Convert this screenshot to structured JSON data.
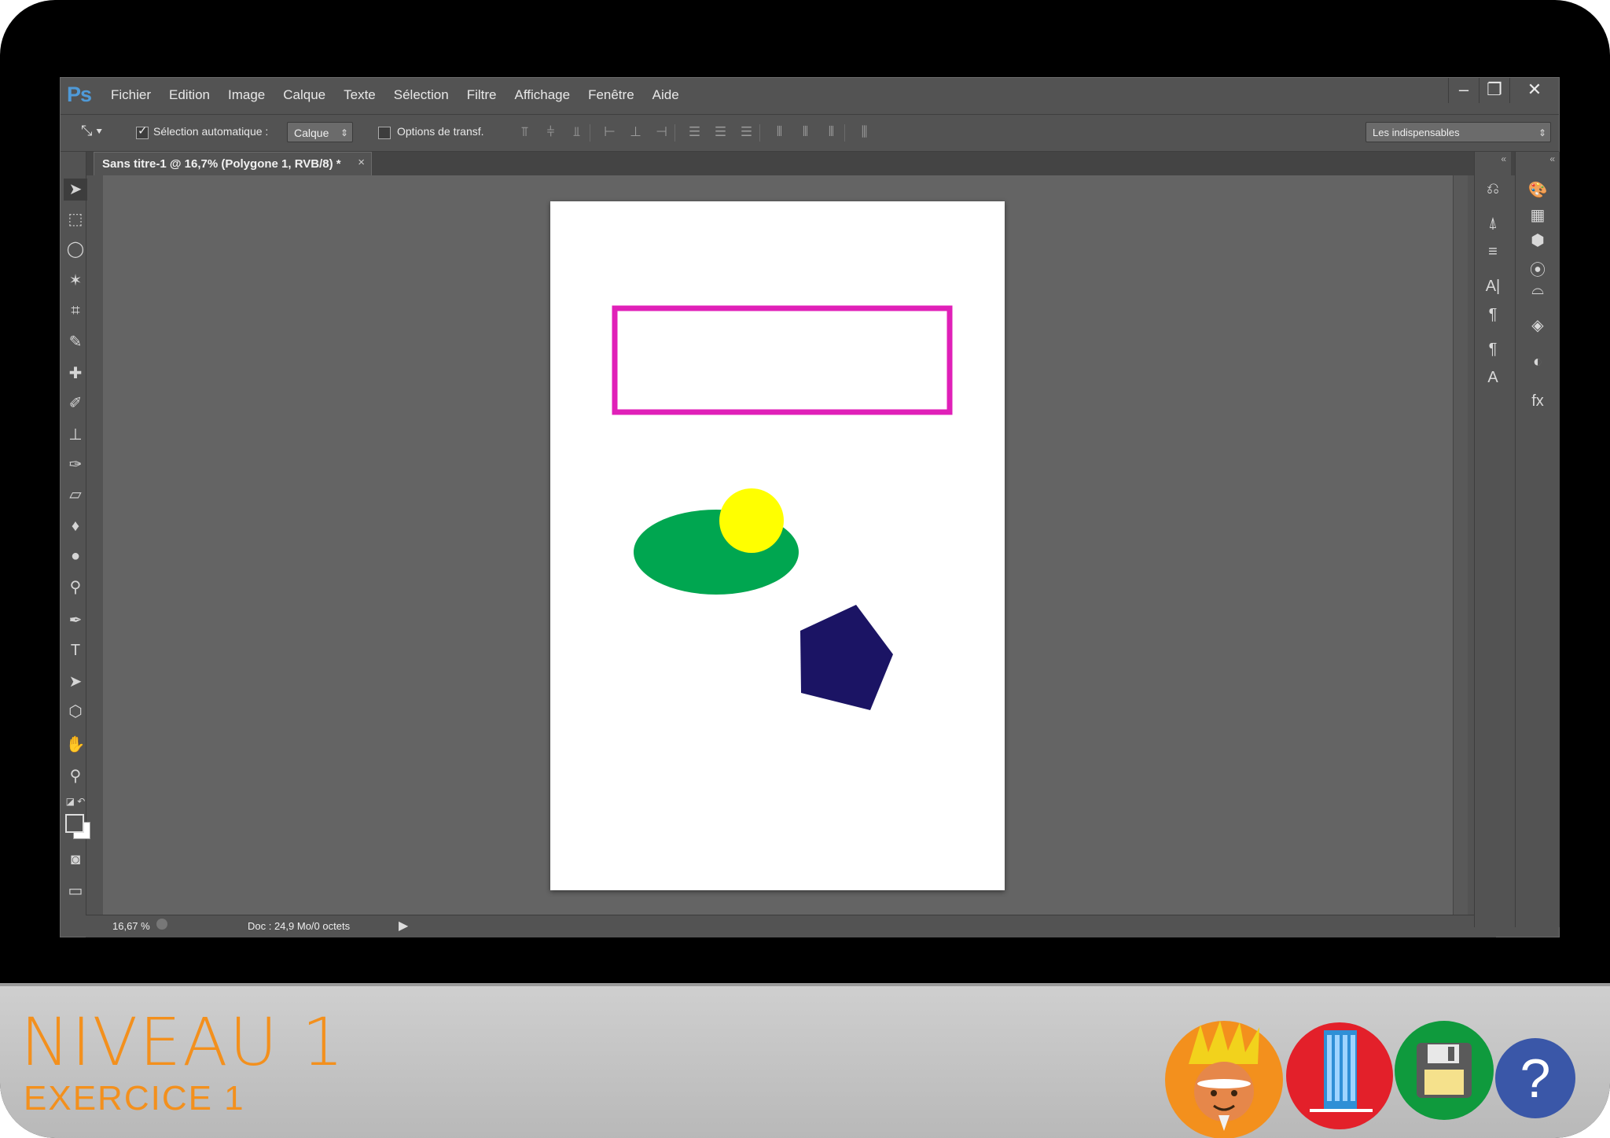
{
  "app": {
    "logo": "Ps",
    "name": "Photoshop"
  },
  "menu": [
    "Fichier",
    "Edition",
    "Image",
    "Calque",
    "Texte",
    "Sélection",
    "Filtre",
    "Affichage",
    "Fenêtre",
    "Aide"
  ],
  "window_buttons": {
    "minimize": "–",
    "restore": "❐",
    "close": "✕"
  },
  "options_bar": {
    "auto_select_label": "Sélection automatique :",
    "auto_select_checked": true,
    "auto_select_value": "Calque",
    "transform_label": "Options de transf.",
    "transform_checked": false,
    "workspace": "Les indispensables"
  },
  "document_tab": {
    "title": "Sans titre-1 @ 16,7% (Polygone 1, RVB/8) *",
    "close": "×"
  },
  "status": {
    "zoom": "16,67 %",
    "doc_info": "Doc : 24,9 Mo/0 octets"
  },
  "canvas_shapes": {
    "rectangle_stroke_color": "#e020b8",
    "ellipse_color": "#00a650",
    "circle_color": "#ffff00",
    "pentagon_color": "#1b1464"
  },
  "bottom": {
    "level": "NIVEAU 1",
    "exercise": "EXERCICE 1",
    "help_symbol": "?"
  },
  "colors": {
    "accent": "#f3901d",
    "ps_blue": "#4f9ad8"
  }
}
